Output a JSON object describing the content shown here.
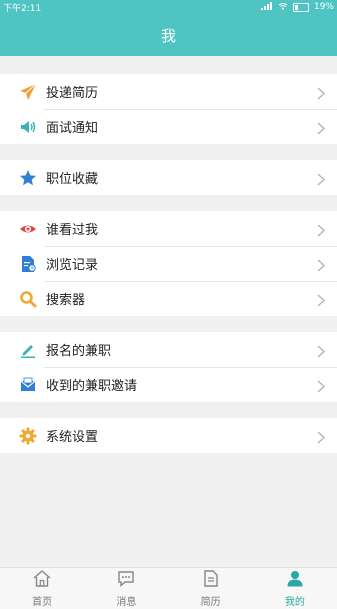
{
  "statusbar": {
    "time": "下午2:11",
    "battery": "19%"
  },
  "header": {
    "title": "我"
  },
  "groups": [
    {
      "items": [
        {
          "label": "投递简历"
        },
        {
          "label": "面试通知"
        }
      ]
    },
    {
      "items": [
        {
          "label": "职位收藏"
        }
      ]
    },
    {
      "items": [
        {
          "label": "谁看过我"
        },
        {
          "label": "浏览记录"
        },
        {
          "label": "搜索器"
        }
      ]
    },
    {
      "items": [
        {
          "label": "报名的兼职"
        },
        {
          "label": "收到的兼职邀请"
        }
      ]
    },
    {
      "items": [
        {
          "label": "系统设置"
        }
      ]
    }
  ],
  "tabbar": {
    "tabs": [
      {
        "label": "首页"
      },
      {
        "label": "消息"
      },
      {
        "label": "简历"
      },
      {
        "label": "我的"
      }
    ],
    "active_index": 3
  },
  "colors": {
    "accent": "#4fc5c3",
    "active_tab": "#2aa8a5"
  }
}
